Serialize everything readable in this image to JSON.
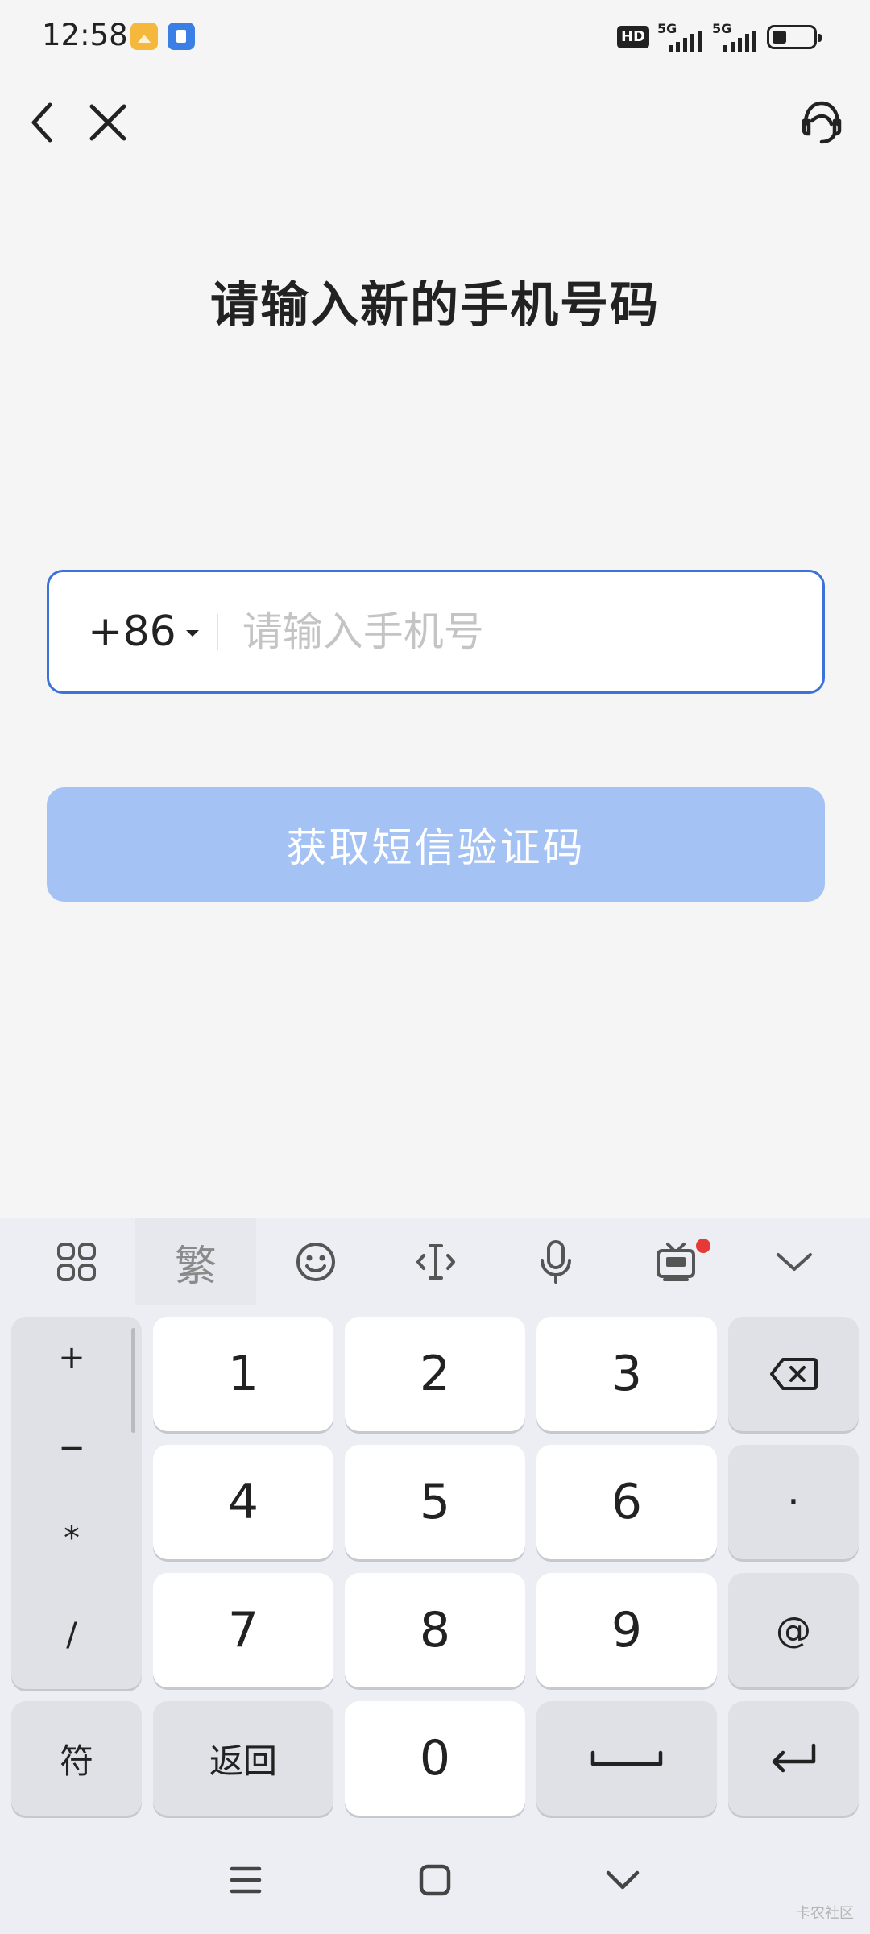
{
  "status_bar": {
    "time": "12:58",
    "network_hd": "HD",
    "sim1_label": "5G",
    "sim2_label": "5G",
    "battery_level": 0.35
  },
  "header": {
    "back_icon": "chevron-left-icon",
    "close_icon": "close-icon",
    "support_icon": "customer-service-headset-icon"
  },
  "main": {
    "title": "请输入新的手机号码",
    "country_code": "+86",
    "phone_value": "",
    "phone_placeholder": "请输入手机号",
    "sms_button_label": "获取短信验证码"
  },
  "colors": {
    "accent": "#3b73d9",
    "button_disabled": "#a4c2f4",
    "background": "#f5f5f6"
  },
  "keyboard": {
    "toolbar": {
      "menu_icon": "grid-icon",
      "traditional_label": "繁",
      "emoji_icon": "emoji-icon",
      "cursor_icon": "cursor-move-icon",
      "voice_icon": "microphone-icon",
      "tv_icon": "tv-icon",
      "collapse_icon": "chevron-down-icon"
    },
    "symbols": [
      "+",
      "−",
      "*",
      "/"
    ],
    "digits": [
      "1",
      "2",
      "3",
      "4",
      "5",
      "6",
      "7",
      "8",
      "9",
      "0"
    ],
    "right_keys": {
      "dot": "·",
      "at": "@"
    },
    "bottom": {
      "symbols_label": "符",
      "back_label": "返回"
    }
  },
  "system_nav": {
    "menu_icon": "menu-icon",
    "home_icon": "home-icon",
    "back_icon": "chevron-down-icon"
  },
  "watermark": "卡农社区"
}
